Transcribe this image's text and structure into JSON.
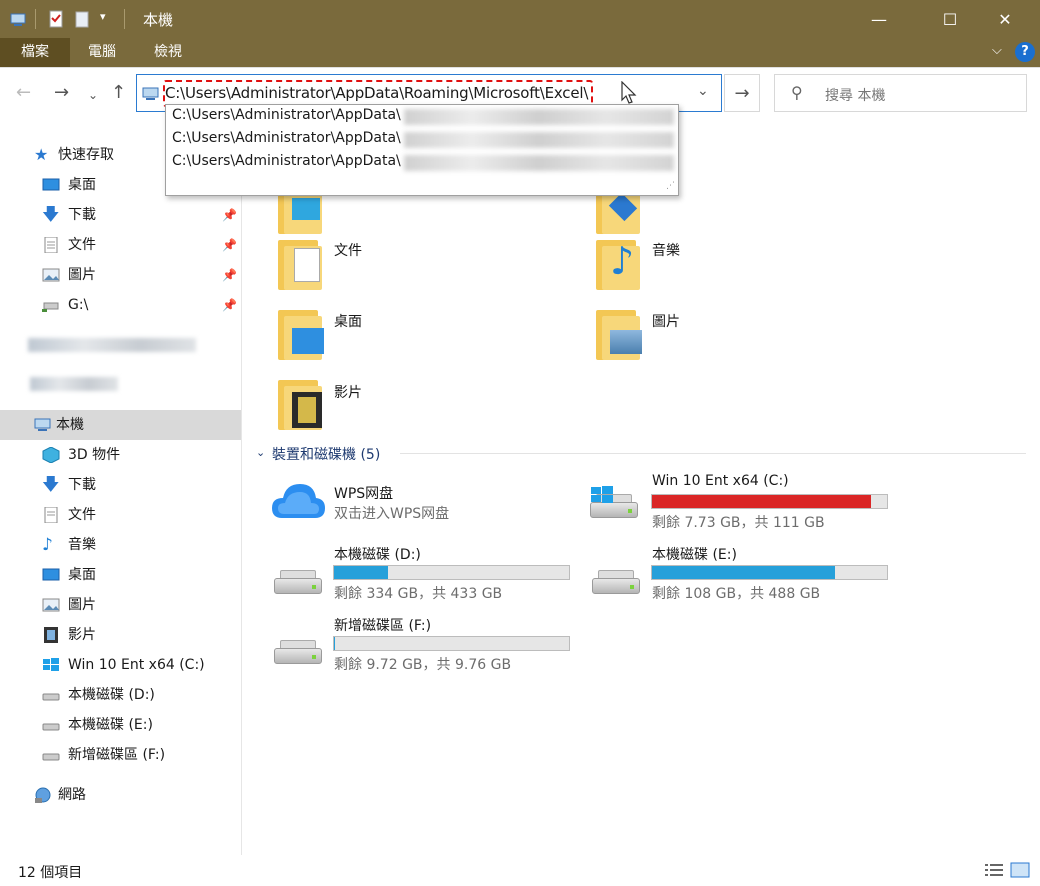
{
  "window": {
    "title": "本機"
  },
  "ribbon": {
    "tabs": [
      "檔案",
      "電腦",
      "檢視"
    ]
  },
  "address": {
    "path": "C:\\Users\\Administrator\\AppData\\Roaming\\Microsoft\\Excel\\",
    "suggestions": [
      "C:\\Users\\Administrator\\AppData\\",
      "C:\\Users\\Administrator\\AppData\\",
      "C:\\Users\\Administrator\\AppData\\"
    ]
  },
  "search": {
    "placeholder": "搜尋 本機"
  },
  "sidebar": {
    "quick_access": "快速存取",
    "quick_items": [
      "桌面",
      "下載",
      "文件",
      "圖片",
      "G:\\"
    ],
    "this_pc": "本機",
    "pc_items": [
      "3D 物件",
      "下載",
      "文件",
      "音樂",
      "桌面",
      "圖片",
      "影片",
      "Win 10 Ent x64 (C:)",
      "本機磁碟 (D:)",
      "本機磁碟 (E:)",
      "新增磁碟區 (F:)"
    ],
    "network": "網路"
  },
  "folders": [
    "文件",
    "音樂",
    "桌面",
    "圖片",
    "影片"
  ],
  "devices": {
    "header": "裝置和磁碟機 (5)",
    "wps": {
      "name": "WPS网盘",
      "subtitle": "双击进入WPS网盘"
    },
    "drives": [
      {
        "name": "Win 10 Ent x64 (C:)",
        "info": "剩餘 7.73 GB，共 111 GB",
        "used": 0.93,
        "color": "#da2626"
      },
      {
        "name": "本機磁碟 (D:)",
        "info": "剩餘 334 GB，共 433 GB",
        "used": 0.23,
        "color": "#26a0da"
      },
      {
        "name": "本機磁碟 (E:)",
        "info": "剩餘 108 GB，共 488 GB",
        "used": 0.78,
        "color": "#26a0da"
      },
      {
        "name": "新增磁碟區 (F:)",
        "info": "剩餘 9.72 GB，共 9.76 GB",
        "used": 0.004,
        "color": "#26a0da"
      }
    ]
  },
  "status": {
    "count": "12 個項目"
  }
}
